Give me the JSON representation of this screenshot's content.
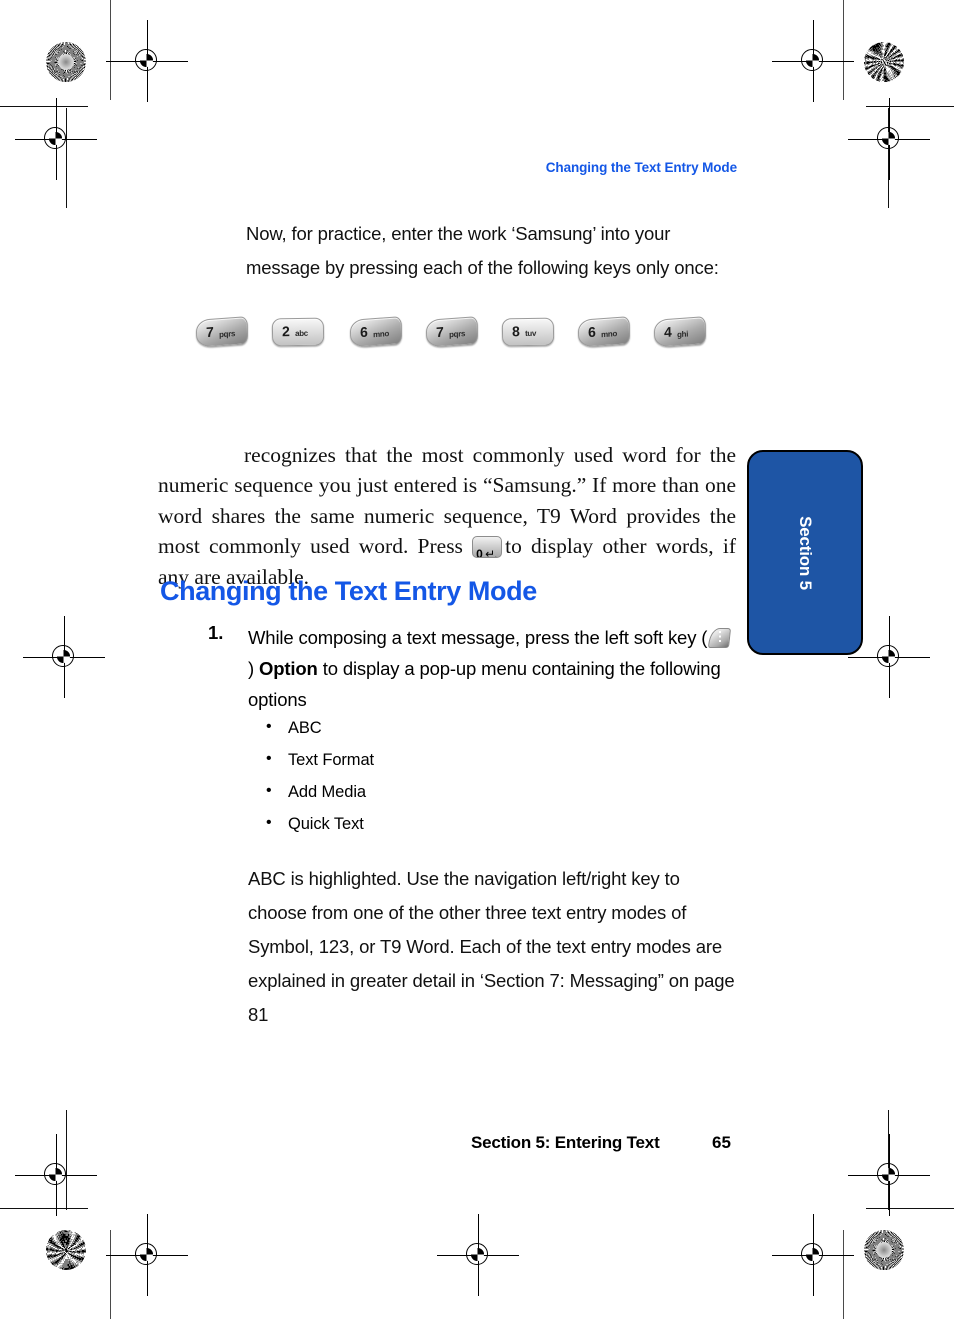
{
  "document": {
    "running_head": "Changing the Text Entry Mode",
    "intro_paragraph": "Now, for practice, enter the work ‘Samsung’ into your message by pressing each of the following keys only once:",
    "serif_paragraph": {
      "before_key": "recognizes that the most commonly used word for the numeric sequence you just entered is “Samsung.” If more than one word shares the same numeric sequence, T9 Word provides the most commonly used word. Press",
      "after_key": "to display other words, if any are available."
    },
    "heading": "Changing the Text Entry Mode",
    "step": {
      "number": "1.",
      "text_before_icon": "While composing a text message, press the left soft key (",
      "text_after_icon": ")",
      "bold_label": "Option",
      "text_tail": "to display a pop-up menu containing the following options"
    },
    "bullets": [
      {
        "label": "ABC"
      },
      {
        "label": "Text Format"
      },
      {
        "label": "Add Media"
      },
      {
        "label": "Quick Text"
      }
    ],
    "closing_paragraph": "ABC is highlighted. Use the navigation left/right key to choose from one of the other three text entry modes of Symbol, 123, or T9 Word. Each of the text entry modes are explained in greater detail in ‘Section 7: Messaging” on page 81",
    "footer": {
      "title": "Section 5: Entering Text",
      "page_number": "65"
    },
    "side_tab": {
      "label": "Section 5"
    }
  },
  "keypad_sequence": [
    {
      "digit": "7",
      "letters": "pqrs",
      "style": "slanted"
    },
    {
      "digit": "2",
      "letters": "abc",
      "style": "flat"
    },
    {
      "digit": "6",
      "letters": "mno",
      "style": "slanted"
    },
    {
      "digit": "7",
      "letters": "pqrs",
      "style": "slanted"
    },
    {
      "digit": "8",
      "letters": "tuv",
      "style": "flat"
    },
    {
      "digit": "6",
      "letters": "mno",
      "style": "slanted"
    },
    {
      "digit": "4",
      "letters": "ghi",
      "style": "slanted"
    }
  ],
  "inline_keys": {
    "zero_key": {
      "digit": "0",
      "symbol": "↵",
      "sub": "ⁿᵇ"
    }
  },
  "colors": {
    "heading_blue": "#1457e6",
    "running_head_blue": "#1457e6",
    "tab_blue": "#1e55a5",
    "body_text": "#111111",
    "page_background": "#ffffff"
  }
}
